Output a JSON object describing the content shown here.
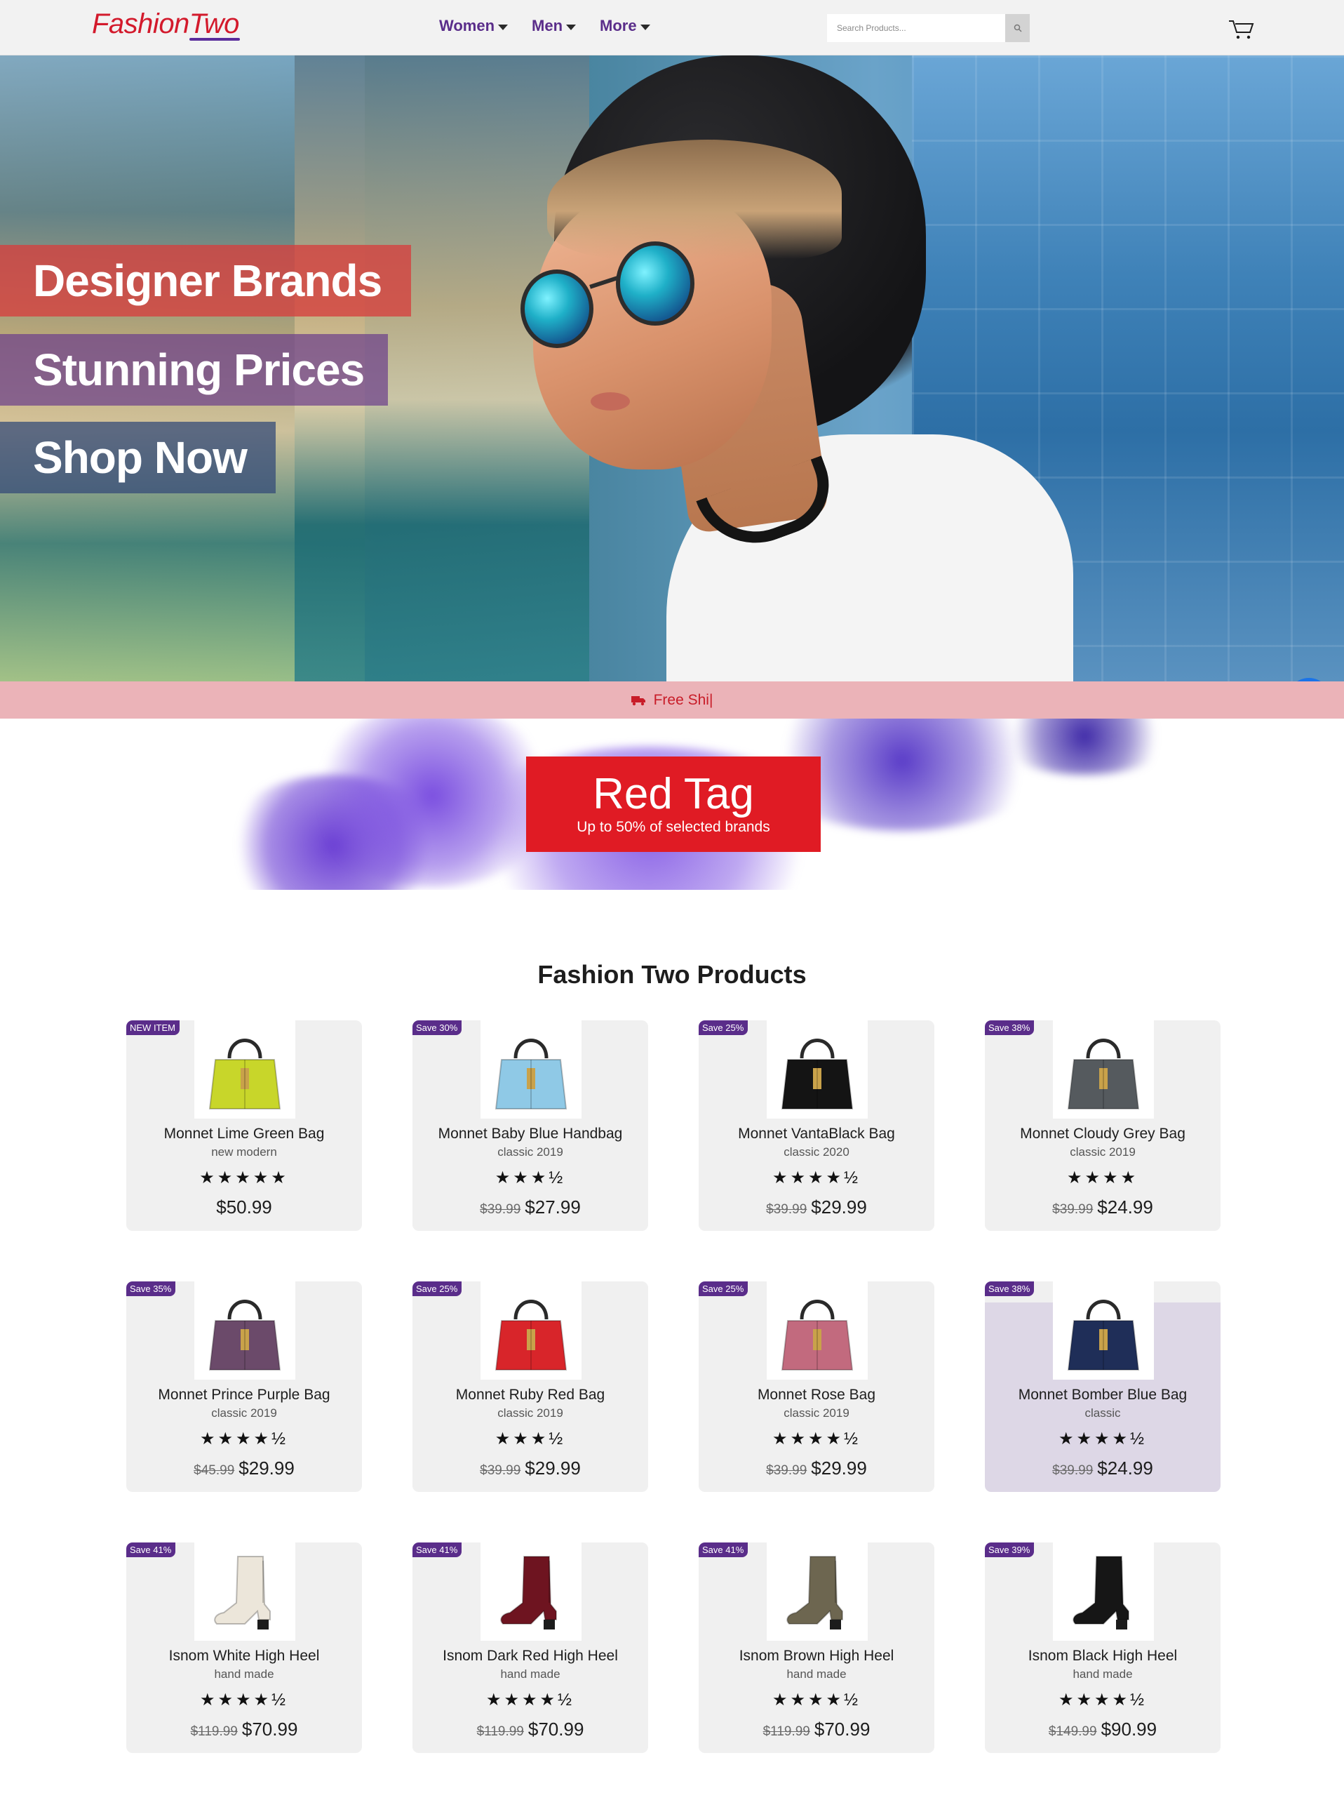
{
  "header": {
    "logo": "FashionTwo",
    "nav": [
      "Women",
      "Men",
      "More"
    ],
    "search_placeholder": "Search Products...",
    "icons": {
      "search": "search-icon",
      "cart": "cart-icon",
      "caret": "chevron-down-icon"
    }
  },
  "hero": {
    "lines": [
      "Designer Brands",
      "Stunning Prices",
      "Shop Now"
    ],
    "colors": {
      "line1": "#d63f3e",
      "line2": "#6c408a",
      "line3": "#344b78"
    }
  },
  "shipping": {
    "text": "Free Shi|",
    "icon": "truck-icon"
  },
  "promo": {
    "title": "Red Tag",
    "subtitle": "Up to 50% of selected brands",
    "color": "#e01b24"
  },
  "products": {
    "title": "Fashion Two Products",
    "items": [
      {
        "badge": "NEW ITEM",
        "name": "Monnet Lime Green Bag",
        "sub": "new modern",
        "rating": 5,
        "stars": "★★★★★",
        "old": "",
        "price": "$50.99",
        "color": "#c8d62a",
        "kind": "bag"
      },
      {
        "badge": "Save 30%",
        "name": "Monnet Baby Blue Handbag",
        "sub": "classic 2019",
        "rating": 3.5,
        "stars": "★★★½",
        "old": "$39.99",
        "price": "$27.99",
        "color": "#8fc9e6",
        "kind": "bag"
      },
      {
        "badge": "Save 25%",
        "name": "Monnet VantaBlack Bag",
        "sub": "classic 2020",
        "rating": 4.5,
        "stars": "★★★★½",
        "old": "$39.99",
        "price": "$29.99",
        "color": "#141414",
        "kind": "bag"
      },
      {
        "badge": "Save 38%",
        "name": "Monnet Cloudy Grey Bag",
        "sub": "classic 2019",
        "rating": 4,
        "stars": "★★★★",
        "old": "$39.99",
        "price": "$24.99",
        "color": "#555a5e",
        "kind": "bag"
      },
      {
        "badge": "Save 35%",
        "name": "Monnet Prince Purple Bag",
        "sub": "classic 2019",
        "rating": 4.5,
        "stars": "★★★★½",
        "old": "$45.99",
        "price": "$29.99",
        "color": "#6b4a6a",
        "kind": "bag"
      },
      {
        "badge": "Save 25%",
        "name": "Monnet Ruby Red Bag",
        "sub": "classic 2019",
        "rating": 3.5,
        "stars": "★★★½",
        "old": "$39.99",
        "price": "$29.99",
        "color": "#d8252a",
        "kind": "bag"
      },
      {
        "badge": "Save 25%",
        "name": "Monnet Rose Bag",
        "sub": "classic 2019",
        "rating": 4.5,
        "stars": "★★★★½",
        "old": "$39.99",
        "price": "$29.99",
        "color": "#c26a7e",
        "kind": "bag"
      },
      {
        "badge": "Save 38%",
        "name": "Monnet Bomber Blue Bag",
        "sub": "classic",
        "rating": 4.5,
        "stars": "★★★★½",
        "old": "$39.99",
        "price": "$24.99",
        "color": "#1f2e58",
        "kind": "bag"
      },
      {
        "badge": "Save 41%",
        "name": "Isnom White High Heel",
        "sub": "hand made",
        "rating": 4.5,
        "stars": "★★★★½",
        "old": "$119.99",
        "price": "$70.99",
        "color": "#ece6da",
        "kind": "boot"
      },
      {
        "badge": "Save 41%",
        "name": "Isnom Dark Red High Heel",
        "sub": "hand made",
        "rating": 4.5,
        "stars": "★★★★½",
        "old": "$119.99",
        "price": "$70.99",
        "color": "#6e1420",
        "kind": "boot"
      },
      {
        "badge": "Save 41%",
        "name": "Isnom Brown High Heel",
        "sub": "hand made",
        "rating": 4.5,
        "stars": "★★★★½",
        "old": "$119.99",
        "price": "$70.99",
        "color": "#6d6650",
        "kind": "boot"
      },
      {
        "badge": "Save 39%",
        "name": "Isnom Black High Heel",
        "sub": "hand made",
        "rating": 4.5,
        "stars": "★★★★½",
        "old": "$149.99",
        "price": "$90.99",
        "color": "#161616",
        "kind": "boot"
      }
    ]
  }
}
